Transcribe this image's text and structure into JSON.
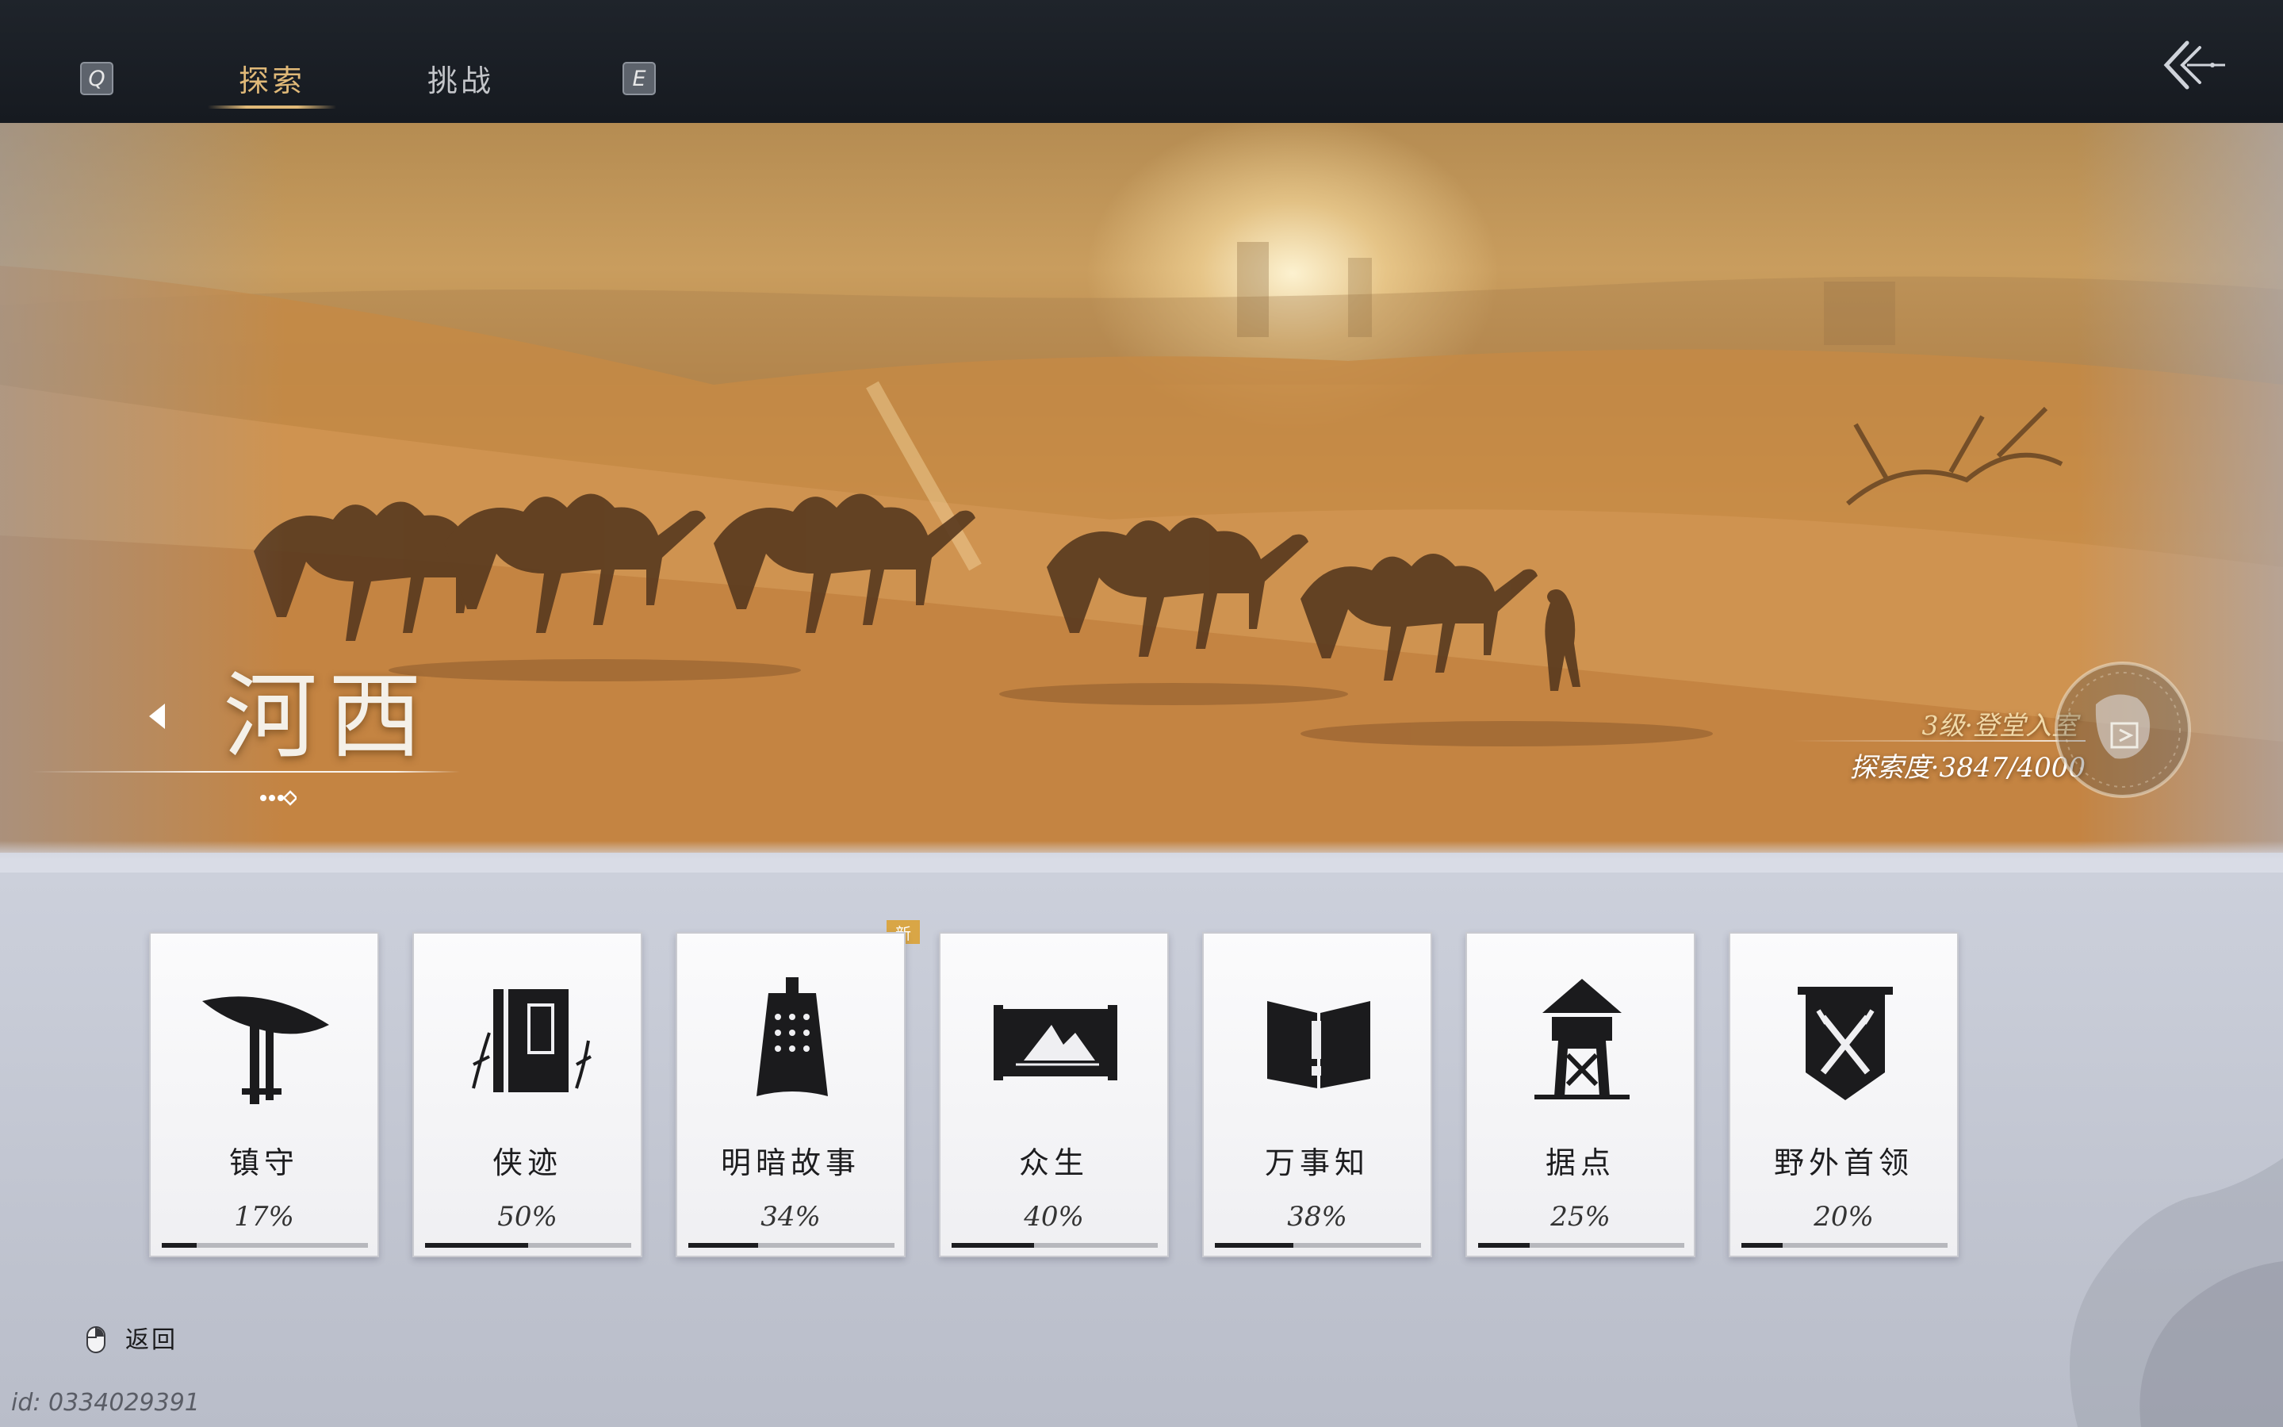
{
  "tabs": {
    "left_key": "Q",
    "right_key": "E",
    "items": [
      {
        "label": "探索",
        "active": true
      },
      {
        "label": "挑战",
        "active": false
      }
    ]
  },
  "region": {
    "name": "河西",
    "rank": "3级·登堂入室",
    "exploration": "探索度·3847/4000"
  },
  "cards": [
    {
      "label": "镇守",
      "percent": "17%",
      "progress": 0.17,
      "icon": "hat-staff-icon"
    },
    {
      "label": "侠迹",
      "percent": "50%",
      "progress": 0.5,
      "icon": "book-icon"
    },
    {
      "label": "明暗故事",
      "percent": "34%",
      "progress": 0.34,
      "icon": "bell-icon",
      "badge": "新"
    },
    {
      "label": "众生",
      "percent": "40%",
      "progress": 0.4,
      "icon": "scroll-painting-icon"
    },
    {
      "label": "万事知",
      "percent": "38%",
      "progress": 0.38,
      "icon": "open-book-exclamation-icon"
    },
    {
      "label": "据点",
      "percent": "25%",
      "progress": 0.25,
      "icon": "watchtower-icon"
    },
    {
      "label": "野外首领",
      "percent": "20%",
      "progress": 0.2,
      "icon": "crossed-swords-banner-icon"
    }
  ],
  "footer": {
    "back_label": "返回",
    "uid": "id: 0334029391"
  },
  "colors": {
    "accent_gold": "#e0b978",
    "topbar": "#1a1e24",
    "badge": "#d9a646"
  }
}
